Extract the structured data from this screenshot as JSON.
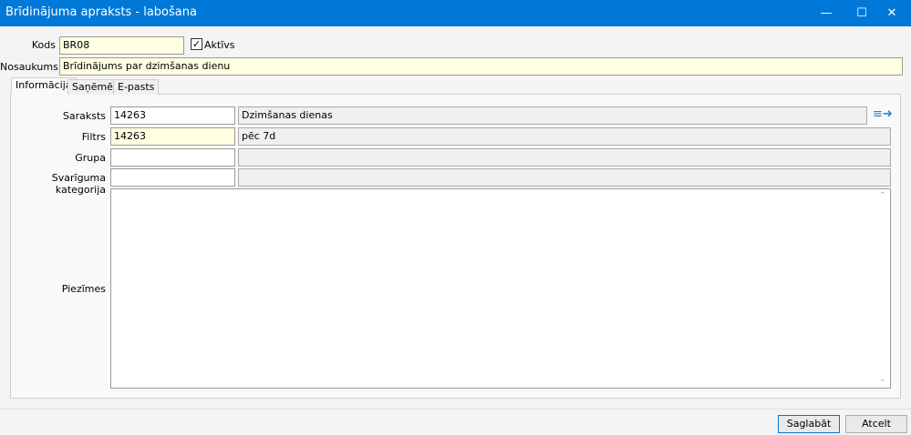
{
  "window": {
    "title": "Brīdinājuma apraksts - labošana"
  },
  "header": {
    "kods_label": "Kods",
    "kods_value": "BR08",
    "aktivs_label": "Aktīvs",
    "aktivs_checked": true,
    "nosaukums_label": "Nosaukums",
    "nosaukums_value": "Brīdinājums par dzimšanas dienu"
  },
  "tabs": [
    {
      "label": "Informācija",
      "active": true
    },
    {
      "label": "Saņēmēji"
    },
    {
      "label": "E-pasts"
    }
  ],
  "form": {
    "saraksts": {
      "label": "Saraksts",
      "code": "14263",
      "name": "Dzimšanas dienas"
    },
    "filtrs": {
      "label": "Filtrs",
      "code": "14263",
      "name": "pēc 7d"
    },
    "grupa": {
      "label": "Grupa",
      "code": "",
      "name": ""
    },
    "svariguma": {
      "label": "Svarīguma kategorija",
      "code": "",
      "name": ""
    },
    "piezimes": {
      "label": "Piezīmes",
      "value": ""
    }
  },
  "buttons": {
    "save": "Saglabāt",
    "cancel": "Atcelt"
  }
}
